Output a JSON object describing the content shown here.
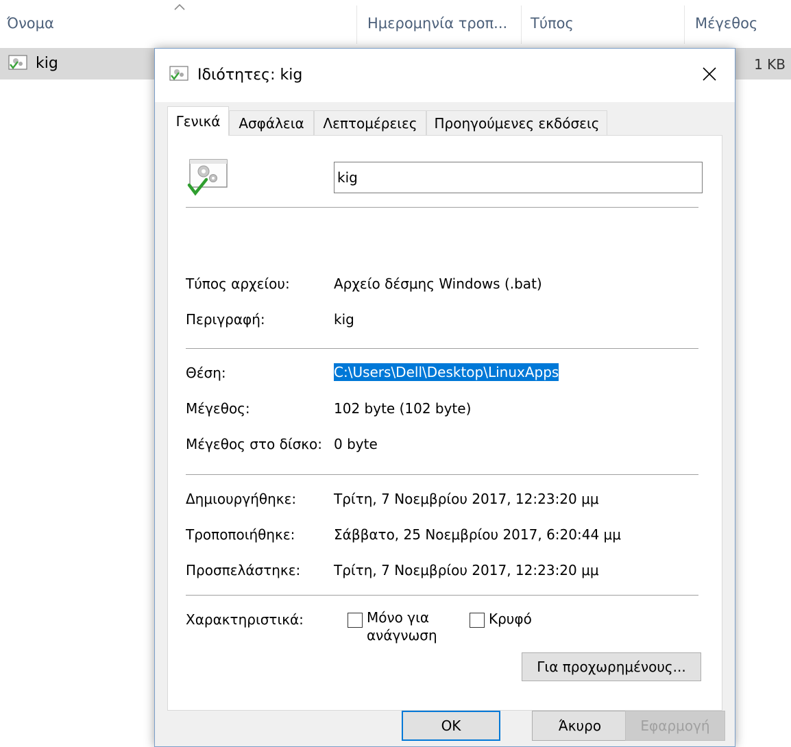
{
  "explorer": {
    "columns": {
      "name": "Όνομα",
      "date_modified": "Ημερομηνία τροπ...",
      "type": "Τύπος",
      "size": "Μέγεθος"
    },
    "file": {
      "name": "kig",
      "size": "1 KB"
    }
  },
  "dialog": {
    "title": "Ιδιότητες: kig",
    "tabs": [
      {
        "label": "Γενικά",
        "active": true
      },
      {
        "label": "Ασφάλεια"
      },
      {
        "label": "Λεπτομέρειες"
      },
      {
        "label": "Προηγούμενες εκδόσεις"
      }
    ],
    "general": {
      "file_name": "kig",
      "file_type_label": "Τύπος αρχείου:",
      "file_type_value": "Αρχείο δέσμης Windows (.bat)",
      "description_label": "Περιγραφή:",
      "description_value": "kig",
      "location_label": "Θέση:",
      "location_value": "C:\\Users\\Dell\\Desktop\\LinuxApps",
      "size_label": "Μέγεθος:",
      "size_value": "102 byte (102 byte)",
      "size_on_disk_label": "Μέγεθος στο δίσκο:",
      "size_on_disk_value": "0 byte",
      "created_label": "Δημιουργήθηκε:",
      "created_value": "Τρίτη, 7 Νοεμβρίου 2017, 12:23:20 μμ",
      "modified_label": "Τροποποιήθηκε:",
      "modified_value": "Σάββατο, 25 Νοεμβρίου 2017, 6:20:44 μμ",
      "accessed_label": "Προσπελάστηκε:",
      "accessed_value": "Τρίτη, 7 Νοεμβρίου 2017, 12:23:20 μμ",
      "attributes_label": "Χαρακτηριστικά:",
      "readonly_line1": "Μόνο για",
      "readonly_line2": "ανάγνωση",
      "hidden_label": "Κρυφό",
      "advanced_button": "Για προχωρημένους..."
    },
    "buttons": {
      "ok": "OK",
      "cancel": "Άκυρο",
      "apply": "Εφαρμογή"
    }
  },
  "icons": {
    "file": "batch-file-gear-icon",
    "close": "close-icon",
    "sort": "sort-up-chevron-icon"
  },
  "colors": {
    "accent": "#0078d7",
    "selection": "#0078d7",
    "column_header_text": "#4c607a"
  }
}
